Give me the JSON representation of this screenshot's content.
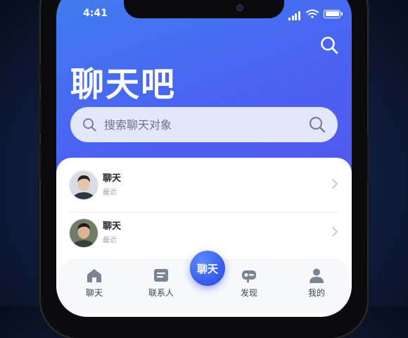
{
  "status_bar": {
    "time": "4:41"
  },
  "header": {
    "title": "聊天吧",
    "search_icon": "search-icon"
  },
  "search": {
    "placeholder": "搜索聊天对象"
  },
  "chats": [
    {
      "name": "聊天",
      "last_message": "最近",
      "time": ""
    },
    {
      "name": "聊天",
      "last_message": "最近",
      "time": ""
    }
  ],
  "tab_bar": {
    "items": [
      {
        "label": "聊天",
        "icon": "home-icon"
      },
      {
        "label": "联系人",
        "icon": "contacts-icon"
      },
      {
        "label": "发现",
        "icon": "discover-icon"
      },
      {
        "label": "我的",
        "icon": "profile-icon"
      }
    ],
    "center_button": "聊天"
  },
  "colors": {
    "accent": "#4a63f0",
    "header_gradient_start": "#3f7df0",
    "header_gradient_end": "#5a4fee"
  }
}
